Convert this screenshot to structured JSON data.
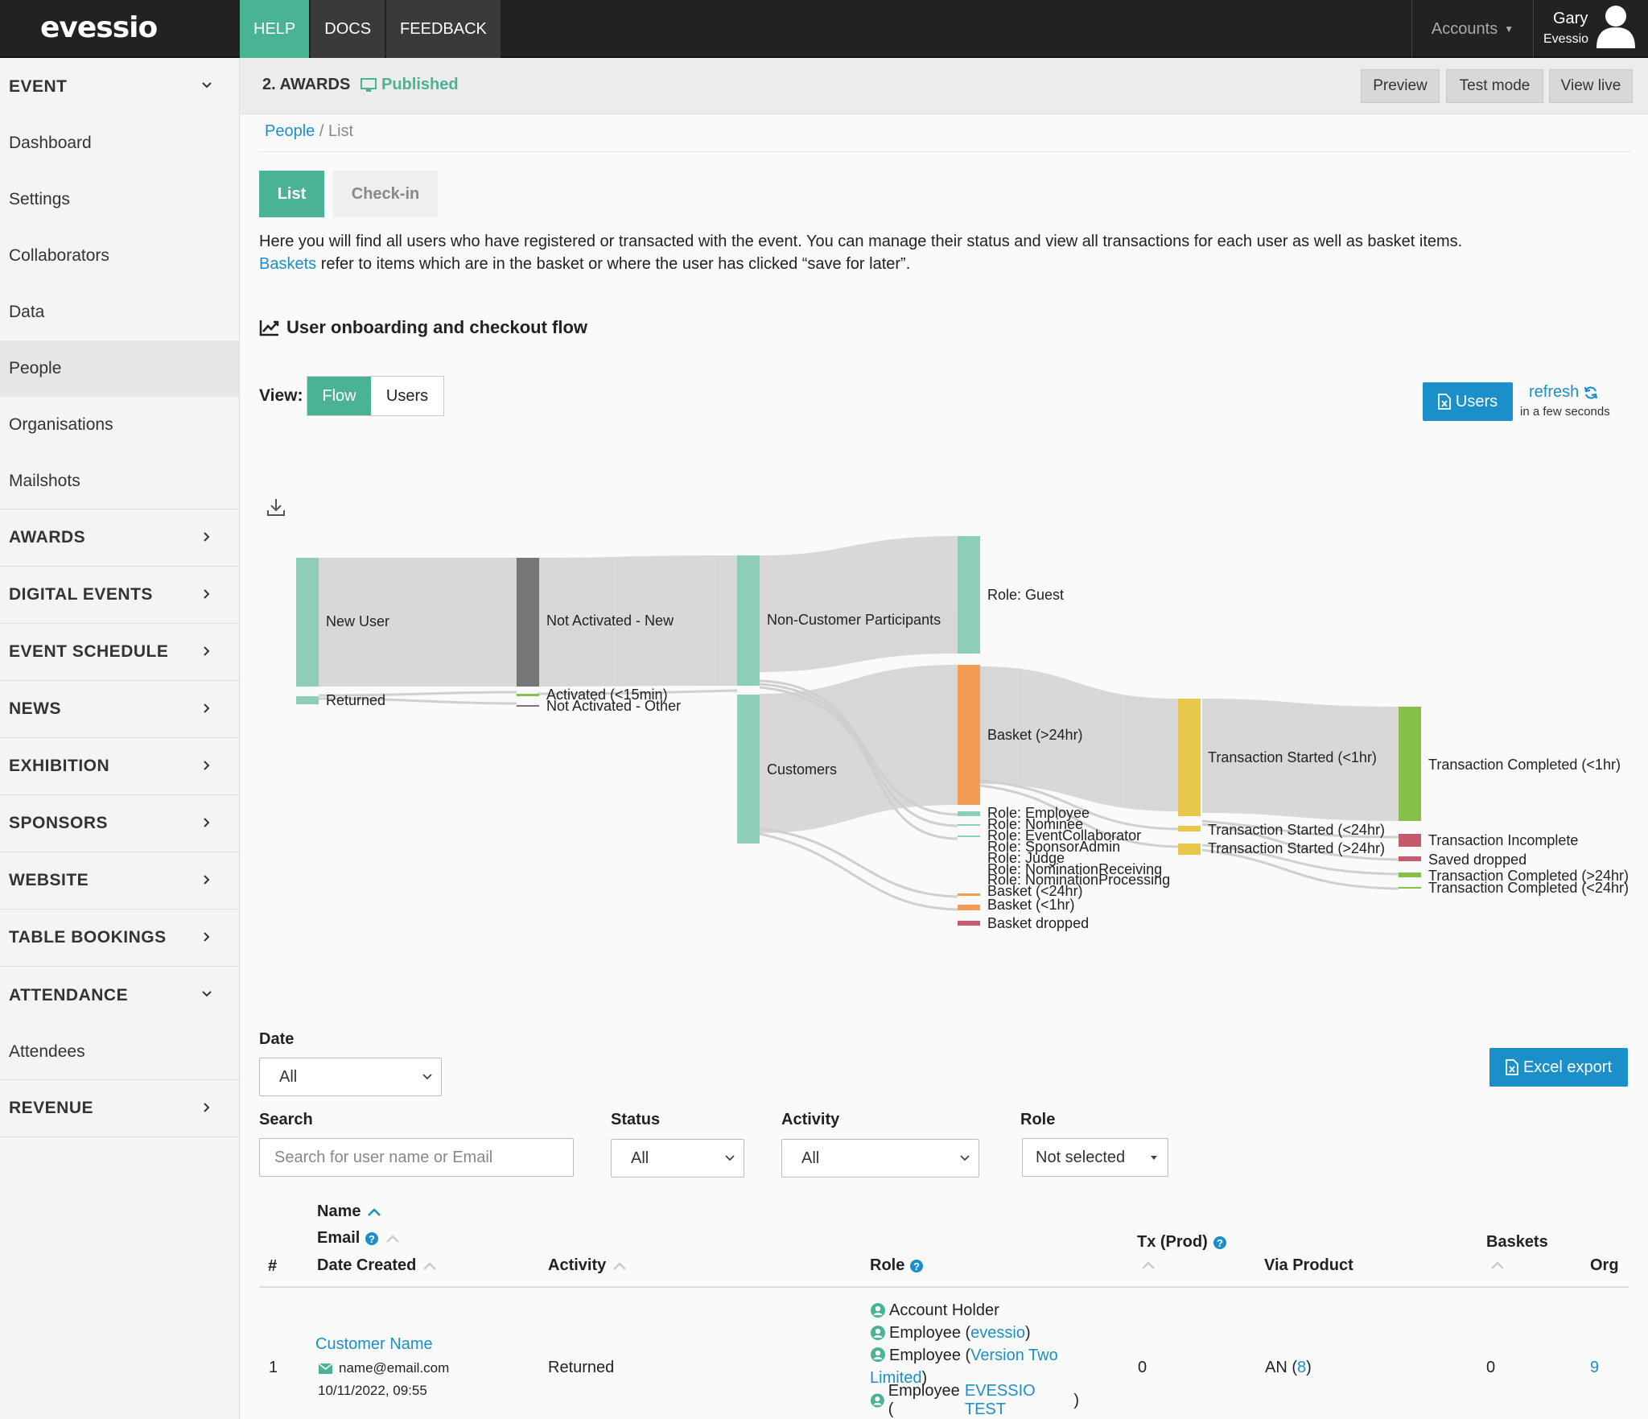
{
  "app": {
    "logo": "evessio"
  },
  "topnav": {
    "items": [
      "HELP",
      "DOCS",
      "FEEDBACK"
    ],
    "accounts": "Accounts",
    "user_name": "Gary",
    "user_org": "Evessio"
  },
  "sidebar": {
    "event_section": "EVENT",
    "event_items": [
      "Dashboard",
      "Settings",
      "Collaborators",
      "Data",
      "People",
      "Organisations",
      "Mailshots"
    ],
    "sections": [
      "AWARDS",
      "DIGITAL EVENTS",
      "EVENT SCHEDULE",
      "NEWS",
      "EXHIBITION",
      "SPONSORS",
      "WEBSITE",
      "TABLE BOOKINGS"
    ],
    "attendance_section": "ATTENDANCE",
    "attendance_items": [
      "Attendees"
    ],
    "revenue_section": "REVENUE"
  },
  "header": {
    "title": "2. AWARDS",
    "status": "Published",
    "preview": "Preview",
    "test_mode": "Test mode",
    "view_live": "View live"
  },
  "breadcrumb": {
    "link": "People",
    "sep": " / ",
    "current": "List"
  },
  "tabs": {
    "list": "List",
    "checkin": "Check-in"
  },
  "description": {
    "line1": "Here you will find all users who have registered or transacted with the event. You can manage their status and view all transactions for each user as well as basket items.",
    "baskets_link": "Baskets",
    "line2": " refer to items which are in the basket or where the user has clicked “save for later”."
  },
  "flow": {
    "title": "User onboarding and checkout flow",
    "view_label": "View:",
    "view_flow": "Flow",
    "view_users": "Users",
    "users_button": "Users",
    "refresh": "refresh",
    "refresh_sub": "in a few seconds"
  },
  "sankey": {
    "nodes": [
      "New User",
      "Returned",
      "Not Activated - New",
      "Activated (<15min)",
      "Not Activated - Other",
      "Non-Customer Participants",
      "Customers",
      "Role: Guest",
      "Basket (>24hr)",
      "Role: Employee",
      "Role: Nominee",
      "Role: EventCollaborator",
      "Role: SponsorAdmin",
      "Role: Judge",
      "Role: NominationReceiving",
      "Role: NominationProcessing",
      "Basket (<24hr)",
      "Basket (<1hr)",
      "Basket dropped",
      "Transaction Started (<1hr)",
      "Transaction Started (<24hr)",
      "Transaction Started (>24hr)",
      "Transaction Completed (<1hr)",
      "Transaction Incomplete",
      "Saved dropped",
      "Transaction Completed (>24hr)",
      "Transaction Completed (<24hr)"
    ],
    "colors": {
      "teal": "#8ecdb7",
      "grey": "#777777",
      "orange": "#f39c55",
      "yellow": "#e8c84a",
      "green": "#86c04a",
      "red": "#c45a6a",
      "link": "#d3d3d3"
    }
  },
  "filters": {
    "date_label": "Date",
    "date_value": "All",
    "search_label": "Search",
    "search_placeholder": "Search for user name or Email",
    "status_label": "Status",
    "status_value": "All",
    "activity_label": "Activity",
    "activity_value": "All",
    "role_label": "Role",
    "role_value": "Not selected",
    "excel_export": "Excel export"
  },
  "table": {
    "headers": {
      "num": "#",
      "name": "Name",
      "email": "Email",
      "date_created": "Date Created",
      "activity": "Activity",
      "role": "Role",
      "tx": "Tx (Prod)",
      "via_product": "Via Product",
      "baskets": "Baskets",
      "org": "Org"
    },
    "rows": [
      {
        "num": "1",
        "name": "Customer Name",
        "email": "name@email.com",
        "date": "10/11/2022, 09:55",
        "activity": "Returned",
        "roles": [
          {
            "label": "Account Holder"
          },
          {
            "label": "Employee (",
            "link": "evessio",
            "end": ")"
          },
          {
            "label": "Employee (",
            "link": "Version Two Limited",
            "end": ")"
          },
          {
            "label": "Employee (",
            "link": "EVESSIO TEST",
            "end": ")"
          }
        ],
        "tx": "0",
        "via_product_prefix": "AN (",
        "via_product_link": "8",
        "via_product_suffix": ")",
        "baskets": "0",
        "org": "9"
      }
    ]
  }
}
